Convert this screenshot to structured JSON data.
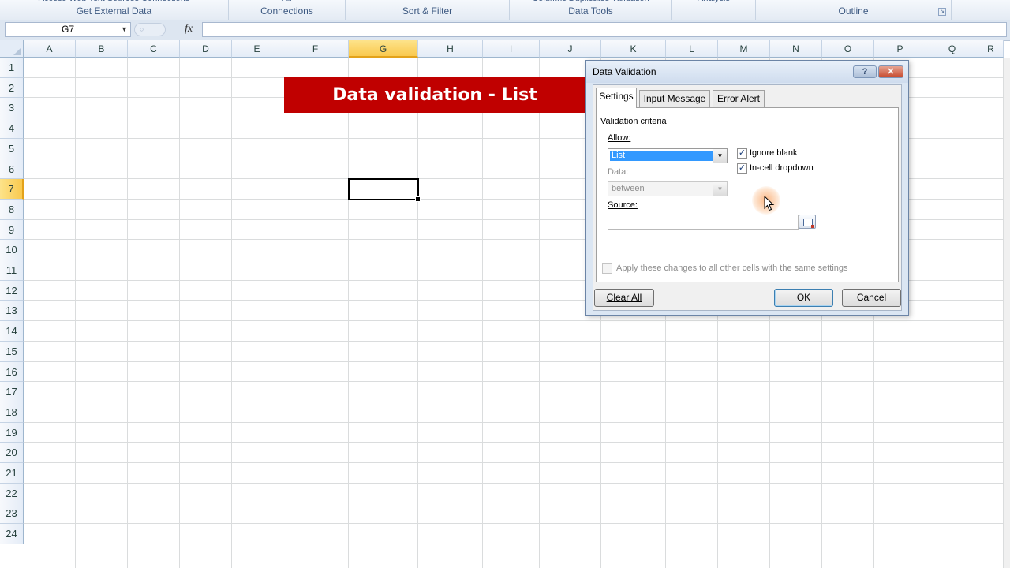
{
  "ribbon": {
    "groups": [
      {
        "cut": "Access   Web   Text   Sources   Connections",
        "caption": "Get External Data",
        "launcher": false
      },
      {
        "cut": "All",
        "caption": "Connections",
        "launcher": false
      },
      {
        "cut": "",
        "caption": "Sort & Filter",
        "launcher": false
      },
      {
        "cut": "Columns  Duplicates  Validation",
        "caption": "Data Tools",
        "launcher": false
      },
      {
        "cut": "Analysis",
        "caption": "",
        "launcher": false
      },
      {
        "cut": "",
        "caption": "Outline",
        "launcher": true
      }
    ]
  },
  "formula_bar": {
    "name_box": "G7",
    "fx_symbol": "fx",
    "formula": ""
  },
  "sheet": {
    "columns": [
      "A",
      "B",
      "C",
      "D",
      "E",
      "F",
      "G",
      "H",
      "I",
      "J",
      "K",
      "L",
      "M",
      "N",
      "O",
      "P",
      "Q",
      "R"
    ],
    "rows": [
      "1",
      "2",
      "3",
      "4",
      "5",
      "6",
      "7",
      "8",
      "9",
      "10",
      "11",
      "12",
      "13",
      "14",
      "15",
      "16",
      "17",
      "18",
      "19",
      "20",
      "21",
      "22",
      "23",
      "24"
    ],
    "active_column": "G",
    "active_row": "7",
    "banner_text": "Data validation - List",
    "banner_color": "#c00000"
  },
  "dialog": {
    "title": "Data Validation",
    "help": "?",
    "close": "✕",
    "tabs": [
      "Settings",
      "Input Message",
      "Error Alert"
    ],
    "selected_tab": "Settings",
    "section": "Validation criteria",
    "allow_label": "Allow:",
    "allow_value": "List",
    "data_label": "Data:",
    "data_value": "between",
    "ignore_blank": {
      "label": "Ignore blank",
      "checked": true
    },
    "in_cell_dropdown": {
      "label": "In-cell dropdown",
      "checked": true
    },
    "source_label": "Source:",
    "source_value": "",
    "apply_all": {
      "label": "Apply these changes to all other cells with the same settings",
      "checked": false
    },
    "buttons": {
      "clear": "Clear All",
      "ok": "OK",
      "cancel": "Cancel"
    },
    "selection_color": "#3399ff"
  }
}
